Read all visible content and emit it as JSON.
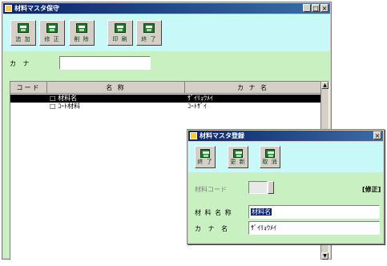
{
  "main_window": {
    "title": "材料マスタ保守",
    "window_buttons": [
      "_",
      "□",
      "×"
    ],
    "toolbar": {
      "buttons": [
        {
          "label": "追 加",
          "icon": "save-icon"
        },
        {
          "label": "修 正",
          "icon": "edit-icon"
        },
        {
          "label": "削 除",
          "icon": "delete-icon"
        },
        {
          "label": "印 刷",
          "icon": "print-icon"
        },
        {
          "label": "終 了",
          "icon": "exit-icon"
        }
      ]
    },
    "search": {
      "label": "カ ナ",
      "value": ""
    },
    "grid": {
      "columns": [
        "コード",
        "名 称",
        "カ ナ 名"
      ],
      "rows": [
        {
          "code": "",
          "name": "□ 材料名",
          "kana": "ｻﾞｲﾘｮｳﾒｲ",
          "selected": true
        },
        {
          "code": "",
          "name": "□ ｺｰﾄ材料",
          "kana": "ｺｰﾄｻﾞｲ",
          "selected": false
        }
      ]
    }
  },
  "sub_window": {
    "title": "材料マスタ登録",
    "window_buttons": [
      "×"
    ],
    "toolbar": {
      "buttons": [
        {
          "label": "終 了",
          "icon": "exit-icon"
        },
        {
          "label": "更 新",
          "icon": "update-icon"
        },
        {
          "label": "取 消",
          "icon": "cancel-icon"
        }
      ]
    },
    "code_label": "材料コード",
    "code_value": "",
    "mode": "[修正]",
    "name_label": "材 料 名 称",
    "name_value": "材料名",
    "kana_label": "カ ナ 名",
    "kana_value": "ｻﾞｲﾘｮｳﾒｲ"
  },
  "colors": {
    "title_bar": "#0a246a",
    "toolbar_bg": "#c8f8f8",
    "body_bg": "#c8f0c0",
    "icon_green": "#1f7a2e"
  }
}
